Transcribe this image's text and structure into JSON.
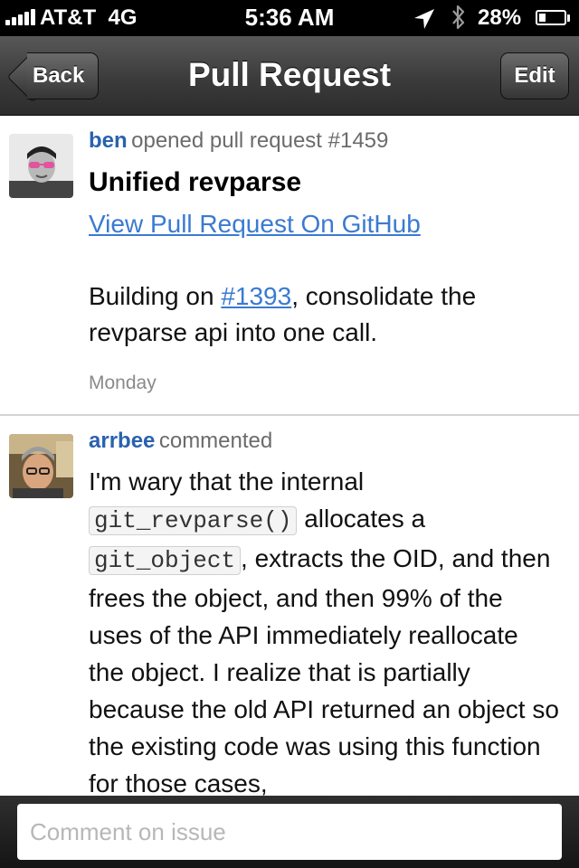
{
  "status_bar": {
    "carrier": "AT&T",
    "network": "4G",
    "time": "5:36 AM",
    "battery": "28%",
    "battery_level": 0.28
  },
  "nav": {
    "back_label": "Back",
    "title": "Pull Request",
    "edit_label": "Edit"
  },
  "pull_request": {
    "author": "ben",
    "action": "opened pull request #1459",
    "title": "Unified revparse",
    "github_link": "View Pull Request On GitHub",
    "body_before": "Building on ",
    "body_link": "#1393",
    "body_after": ", consolidate the revparse api into one call.",
    "date": "Monday"
  },
  "comment": {
    "author": "arrbee",
    "action": "commented",
    "text_1": "I'm wary that the internal ",
    "code_1": "git_revparse()",
    "text_2": " allocates a ",
    "code_2": "git_object",
    "text_3": ", extracts the OID, and then frees the object, and then 99% of the uses of the API immediately reallocate the object. I realize that is partially because the old API returned an object so the existing code was using this function for those cases,"
  },
  "comment_bar": {
    "placeholder": "Comment on issue"
  },
  "colors": {
    "author_blue": "#2a62ad",
    "link_blue": "#3a7ad2",
    "nav_dark": "#3b3b3b"
  }
}
